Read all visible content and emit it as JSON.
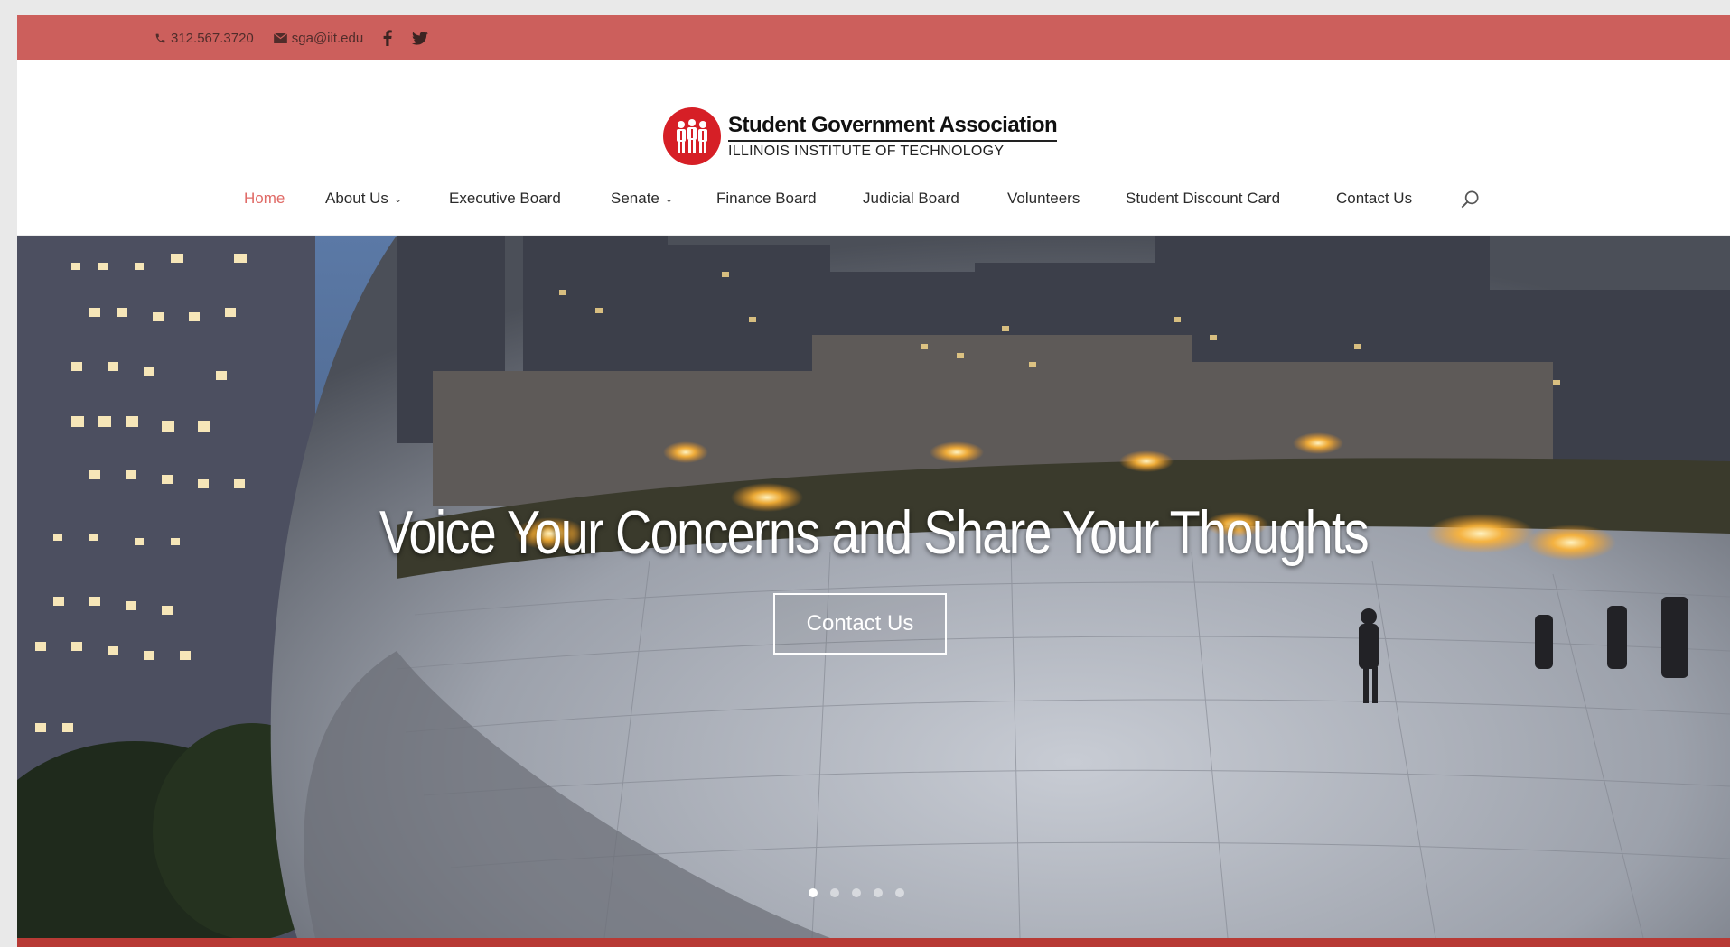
{
  "topbar": {
    "phone": "312.567.3720",
    "email": "sga@iit.edu",
    "social": [
      "facebook-icon",
      "twitter-icon"
    ],
    "bg_color": "#cc5f5c"
  },
  "logo": {
    "title": "Student Government Association",
    "subtitle": "ILLINOIS INSTITUTE OF TECHNOLOGY",
    "brand_color": "#d61f26"
  },
  "nav": {
    "items": [
      {
        "label": "Home",
        "active": true
      },
      {
        "label": "About Us",
        "dropdown": true
      },
      {
        "label": "Executive Board"
      },
      {
        "label": "Senate",
        "dropdown": true
      },
      {
        "label": "Finance Board"
      },
      {
        "label": "Judicial Board"
      },
      {
        "label": "Volunteers"
      },
      {
        "label": "Student Discount Card"
      },
      {
        "label": "Contact Us"
      }
    ],
    "active_color": "#e06a66",
    "search_icon": "search-icon"
  },
  "hero": {
    "title": "Voice Your Concerns and Share Your Thoughts",
    "button_label": "Contact Us",
    "slide_count": 5,
    "active_slide": 1
  }
}
